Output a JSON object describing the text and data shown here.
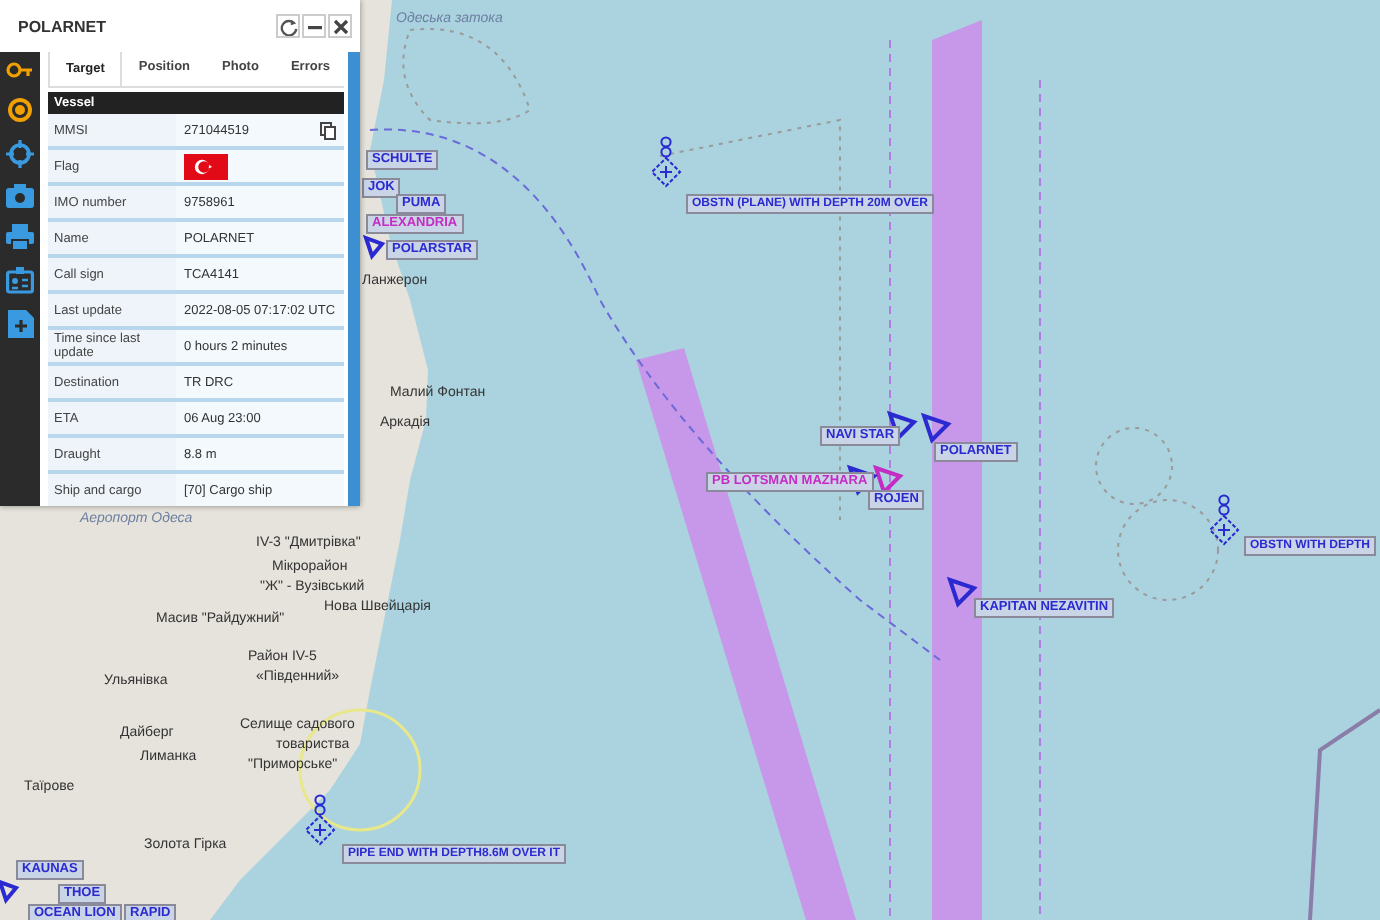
{
  "panel": {
    "title": "POLARNET",
    "tabs": [
      {
        "label": "Target",
        "selected": true
      },
      {
        "label": "Position",
        "selected": false
      },
      {
        "label": "Photo",
        "selected": false
      },
      {
        "label": "Errors",
        "selected": false
      }
    ],
    "section": "Vessel",
    "rows": [
      {
        "label": "MMSI",
        "value": "271044519",
        "kind": "copy"
      },
      {
        "label": "Flag",
        "kind": "flag"
      },
      {
        "label": "IMO number",
        "value": "9758961",
        "kind": "text"
      },
      {
        "label": "Name",
        "value": "POLARNET",
        "kind": "text"
      },
      {
        "label": "Call sign",
        "value": "TCA4141",
        "kind": "text"
      },
      {
        "label": "Last update",
        "value": "2022-08-05 07:17:02 UTC",
        "kind": "text"
      },
      {
        "label": "Time since last update",
        "value": "0 hours 2 minutes",
        "kind": "text"
      },
      {
        "label": "Destination",
        "value": "TR DRC",
        "kind": "text"
      },
      {
        "label": "ETA",
        "value": "06 Aug 23:00",
        "kind": "text"
      },
      {
        "label": "Draught",
        "value": "8.8 m",
        "kind": "text"
      },
      {
        "label": "Ship and cargo",
        "value": "[70] Cargo ship",
        "kind": "text"
      }
    ]
  },
  "map": {
    "places": [
      "Одеська затока",
      "Ланжерон",
      "Малий Фонтан",
      "Аркадія",
      "Аеропорт Одеса",
      "IV-3 \"Дмитрівка\"",
      "Мікрорайон",
      "\"Ж\" - Вузівський",
      "Нова Швейцарія",
      "Масив \"Райдужний\"",
      "Район IV-5",
      "«Південний»",
      "Ульянівка",
      "Дайберг",
      "Лиманка",
      "Селище садового",
      "товариства",
      "\"Приморське\"",
      "Таїрове",
      "Золота Гірка"
    ],
    "vessels": [
      {
        "name": "SCHULTE",
        "color": "#2a2ad0"
      },
      {
        "name": "JOK",
        "color": "#2a2ad0"
      },
      {
        "name": "PUMA",
        "color": "#2a2ad0"
      },
      {
        "name": "ALEXANDRIA",
        "color": "#c42cc4"
      },
      {
        "name": "POLARSTAR",
        "color": "#2a2ad0"
      },
      {
        "name": "NAVI STAR",
        "color": "#2a2ad0"
      },
      {
        "name": "PB LOTSMAN MAZHARA",
        "color": "#c42cc4"
      },
      {
        "name": "ROJEN",
        "color": "#2a2ad0"
      },
      {
        "name": "POLARNET",
        "color": "#2a2ad0"
      },
      {
        "name": "KAPITAN NEZAVITIN",
        "color": "#2a2ad0"
      },
      {
        "name": "KAUNAS",
        "color": "#2a2ad0"
      },
      {
        "name": "THOE",
        "color": "#2a2ad0"
      },
      {
        "name": "OCEAN LION",
        "color": "#2a2ad0"
      },
      {
        "name": "RAPID",
        "color": "#2a2ad0"
      }
    ],
    "obstructions": [
      "OBSTN (PLANE) WITH DEPTH 20M OVER",
      "OBSTN WITH DEPTH",
      "PIPE END WITH DEPTH8.6M OVER IT"
    ]
  }
}
